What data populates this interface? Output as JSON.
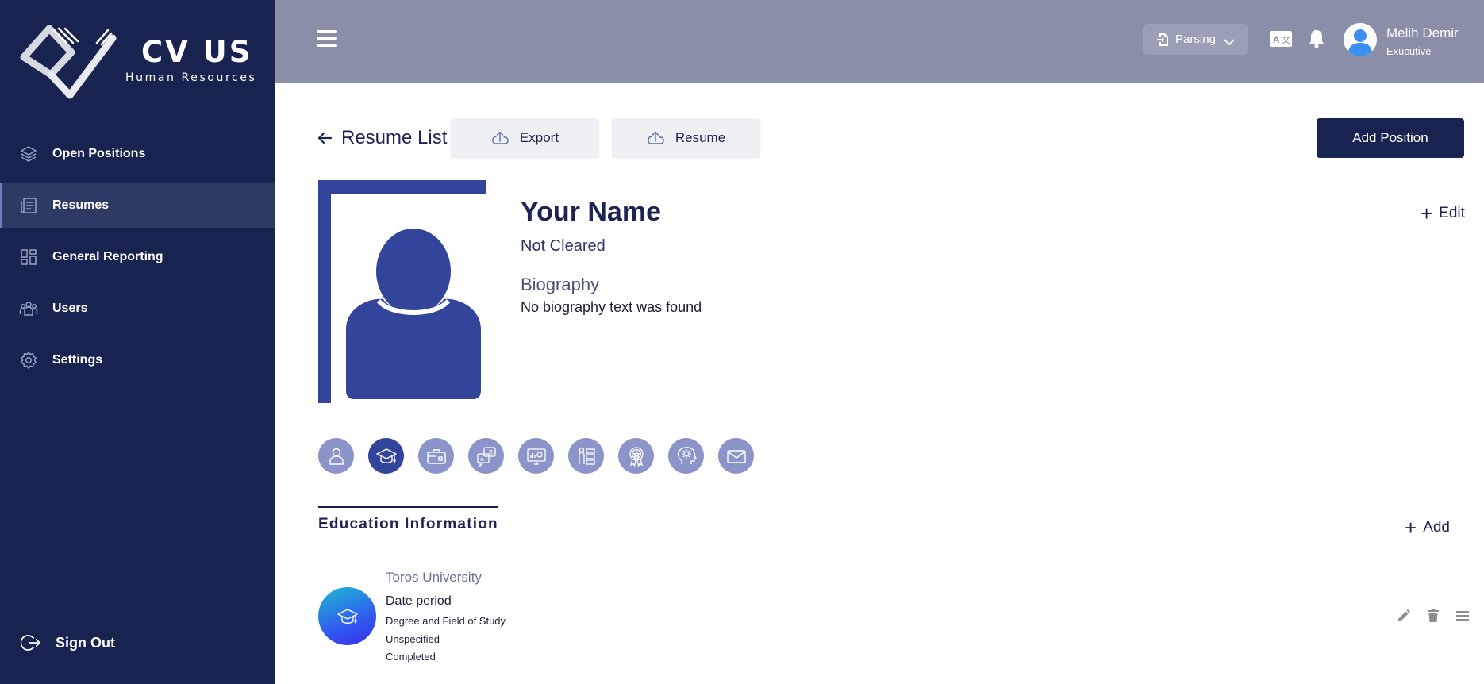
{
  "brand": {
    "title": "CV US",
    "subtitle": "Human Resources"
  },
  "sidebar": {
    "items": [
      {
        "label": "Open Positions",
        "icon": "layers-icon",
        "active": false
      },
      {
        "label": "Resumes",
        "icon": "resumes-icon",
        "active": true
      },
      {
        "label": "General Reporting",
        "icon": "grid-icon",
        "active": false
      },
      {
        "label": "Users",
        "icon": "users-icon",
        "active": false
      },
      {
        "label": "Settings",
        "icon": "gear-icon",
        "active": false
      }
    ],
    "signout": "Sign Out"
  },
  "topbar": {
    "parsing_label": "Parsing",
    "user": {
      "name": "Melih Demir",
      "role": "Exucutive"
    }
  },
  "actions": {
    "back_label": "Resume List",
    "export_label": "Export",
    "resume_label": "Resume",
    "add_position_label": "Add Position"
  },
  "profile": {
    "name": "Your Name",
    "clearance": "Not Cleared",
    "biography_title": "Biography",
    "biography_text": "No biography text was found",
    "edit_label": "Edit"
  },
  "section_tabs": [
    "person-icon",
    "graduation-cap-icon",
    "briefcase-icon",
    "languages-icon",
    "computer-icon",
    "skills-list-icon",
    "award-icon",
    "brain-gear-icon",
    "mail-icon"
  ],
  "education": {
    "title": "Education Information",
    "add_label": "Add",
    "entries": [
      {
        "school": "Toros University",
        "date": "Date period",
        "degree": "Degree and Field of Study",
        "field": "Unspecified",
        "status": "Completed"
      }
    ]
  },
  "colors": {
    "sidebar_bg": "#18234f",
    "topbar_bg": "#8a8fa8",
    "accent": "#33459a",
    "icon_bg": "#8b95c9"
  }
}
